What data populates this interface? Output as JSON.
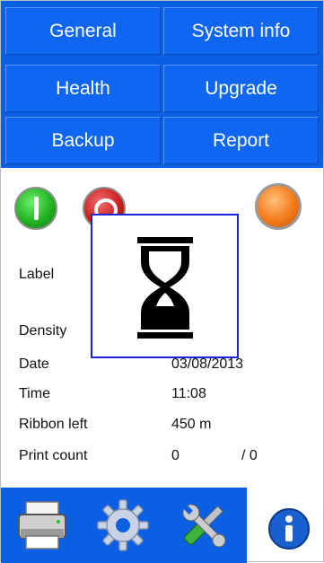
{
  "menu": {
    "general": "General",
    "system_info": "System info",
    "health": "Health",
    "upgrade": "Upgrade",
    "backup": "Backup",
    "report": "Report"
  },
  "status": {
    "label_label": "Label",
    "density_label": "Density",
    "date_label": "Date",
    "date_value": "03/08/2013",
    "time_label": "Time",
    "time_value": "11:08",
    "ribbon_label": "Ribbon left",
    "ribbon_value": "450 m",
    "print_count_label": "Print count",
    "print_count_value": "0",
    "print_count_total": "/ 0"
  },
  "icons": {
    "start": "power-on-icon",
    "stop": "power-off-icon",
    "status_light": "status-light-icon",
    "busy": "hourglass-icon",
    "printer": "printer-icon",
    "settings": "gear-icon",
    "tools": "wrench-screwdriver-icon",
    "info": "info-icon"
  },
  "colors": {
    "menu_blue": "#0e66f2",
    "ready_green": "#22b322",
    "stop_red": "#cc1f1f",
    "status_orange": "#f27a1a",
    "dialog_border": "#1c25d6"
  }
}
